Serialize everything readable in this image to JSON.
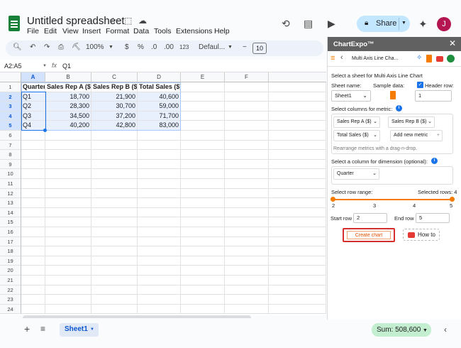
{
  "doc": {
    "title": "Untitled spreadsheet"
  },
  "menu": [
    "File",
    "Edit",
    "View",
    "Insert",
    "Format",
    "Data",
    "Tools",
    "Extensions",
    "Help"
  ],
  "header": {
    "share": "Share",
    "avatar": "J"
  },
  "toolbar": {
    "zoom": "100%",
    "currency": "$",
    "percent": "%",
    "dec_decrease": ".0",
    "dec_increase": ".00",
    "number_format": "123",
    "font": "Defaul...",
    "minus": "−",
    "font_size": "10"
  },
  "formula": {
    "namebox": "A2:A5",
    "fx": "fx",
    "value": "Q1"
  },
  "grid": {
    "columns": [
      "A",
      "B",
      "C",
      "D",
      "E",
      "F"
    ],
    "rows": [
      "1",
      "2",
      "3",
      "4",
      "5",
      "6",
      "7",
      "8",
      "9",
      "10",
      "11",
      "12",
      "13",
      "14",
      "15",
      "16",
      "17",
      "18",
      "19",
      "20",
      "21",
      "22",
      "23",
      "24"
    ],
    "headers": [
      "Quarter",
      "Sales Rep A ($)",
      "Sales Rep B ($)",
      "Total Sales ($)"
    ],
    "data": [
      [
        "Q1",
        "18,700",
        "21,900",
        "40,600"
      ],
      [
        "Q2",
        "28,300",
        "30,700",
        "59,000"
      ],
      [
        "Q3",
        "34,500",
        "37,200",
        "71,700"
      ],
      [
        "Q4",
        "40,200",
        "42,800",
        "83,000"
      ]
    ]
  },
  "bottom": {
    "add": "+",
    "sheet_tab": "Sheet1",
    "sum": "Sum: 508,600"
  },
  "sidebar": {
    "title": "ChartExpo™",
    "close": "✕",
    "chart_name": "Multi Axis Line Cha...",
    "select_sheet": "Select a sheet for Multi Axis Line Chart",
    "sheet_name_label": "Sheet name:",
    "sample_data_label": "Sample data:",
    "header_row_label": "Header row:",
    "sheet_value": "Sheet1",
    "header_row_value": "1",
    "select_metric": "Select columns for metric:",
    "metrics": [
      "Sales Rep A ($)",
      "Sales Rep B ($)",
      "Total Sales ($)"
    ],
    "add_metric": "Add new metric",
    "rearrange": "Rearrange metrics with a drag-n-drop.",
    "select_dimension": "Select a column for dimension (optional):",
    "dimension_value": "Quarter",
    "row_range": "Select row range:",
    "selected_rows": "Selected rows: 4",
    "ticks": [
      "2",
      "3",
      "4",
      "5"
    ],
    "start_row_label": "Start row",
    "start_row_value": "2",
    "end_row_label": "End row",
    "end_row_value": "5",
    "create_chart": "Create chart",
    "how_to": "How to"
  },
  "colors": {
    "accent": "#1a73e8",
    "share_bg": "#c2e7ff",
    "sheets_green": "#188038",
    "chartexpo_orange": "#f57c00",
    "create_border": "#d32f2f"
  }
}
